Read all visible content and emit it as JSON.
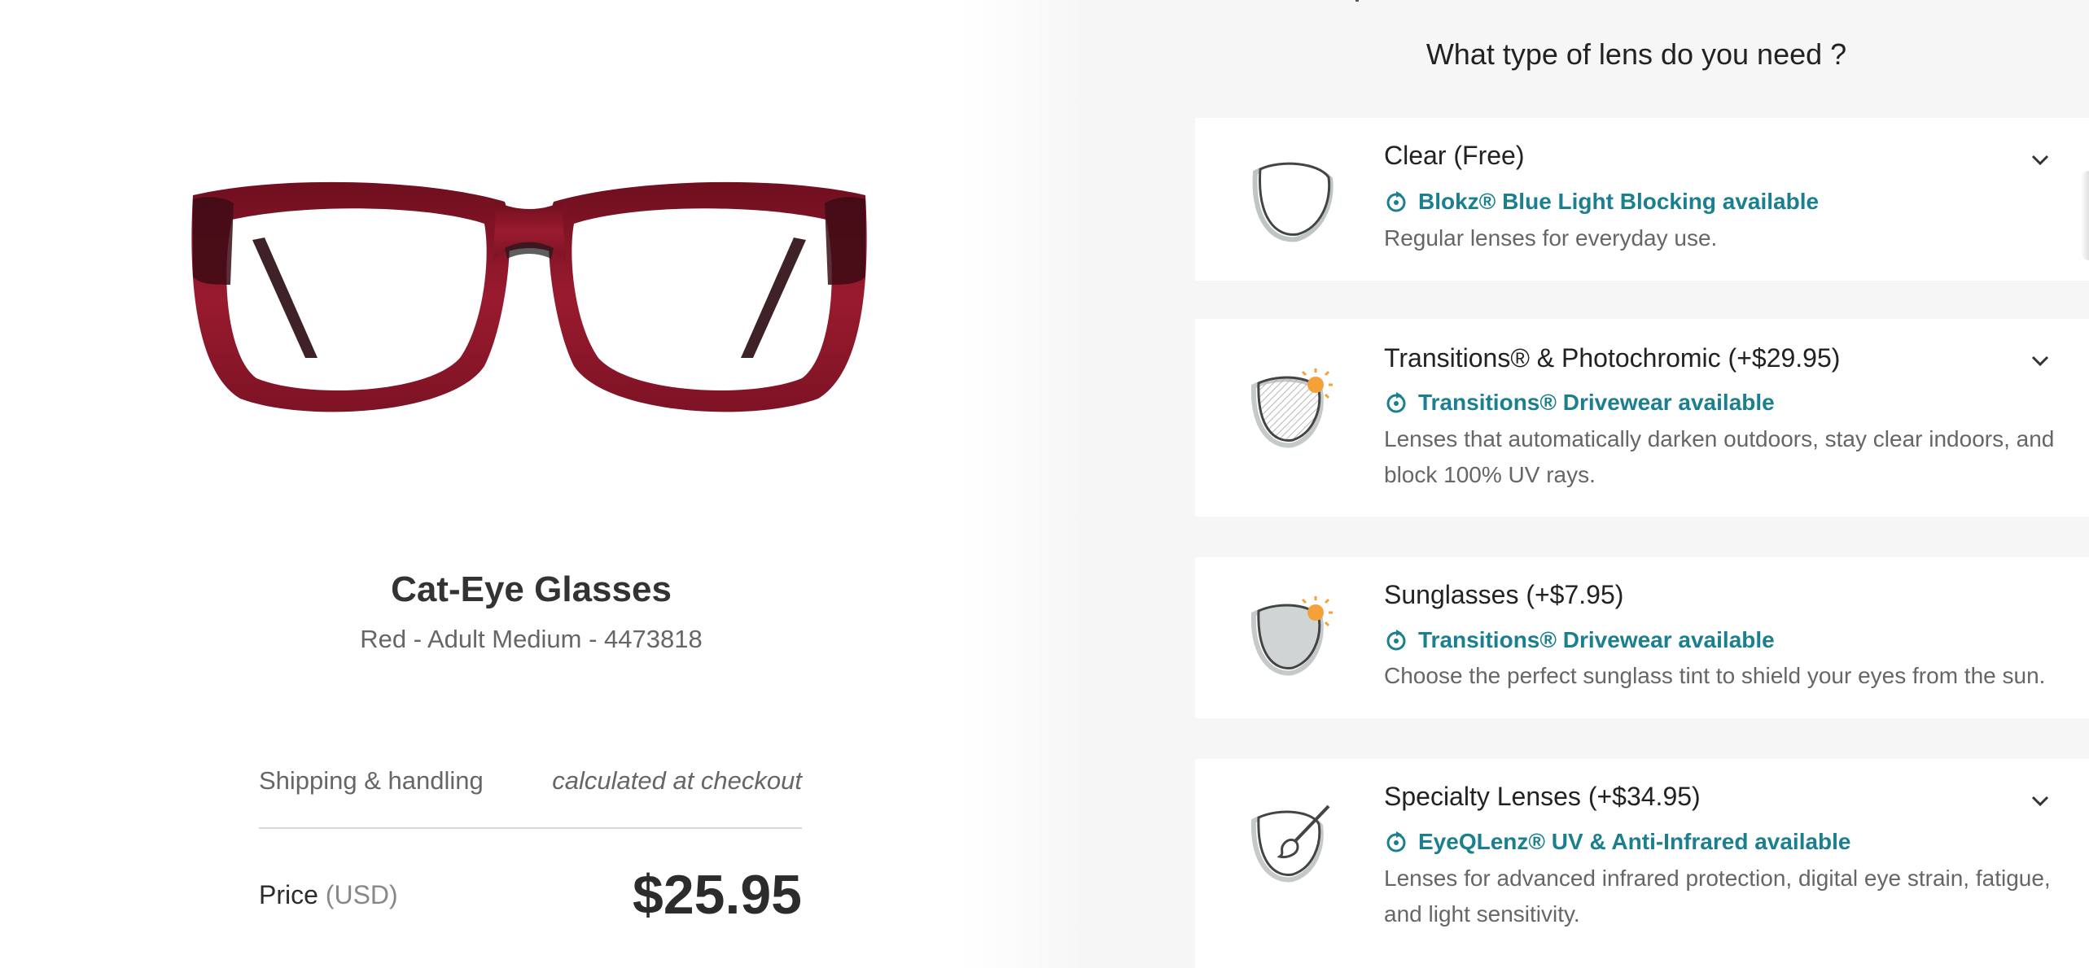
{
  "product": {
    "name": "Cat-Eye Glasses",
    "details": "Red - Adult Medium - 4473818",
    "frame_color": "#8b1628"
  },
  "summary": {
    "shipping_label": "Shipping & handling",
    "shipping_value": "calculated at checkout",
    "price_label": "Price",
    "price_currency": "(USD)",
    "price_value": "$25.95"
  },
  "lens_selector": {
    "question": "What type of lens do you need ?",
    "accent_color": "#1a7f8e",
    "options": [
      {
        "title": "Clear",
        "price": "(Free)",
        "feature": "Blokz® Blue Light Blocking available",
        "description": "Regular lenses for everyday use.",
        "icon": "clear-lens-icon",
        "expandable": true
      },
      {
        "title": "Transitions® & Photochromic",
        "price": "(+$29.95)",
        "feature": "Transitions® Drivewear available",
        "description": "Lenses that automatically darken outdoors, stay clear indoors, and block 100% UV rays.",
        "icon": "photochromic-lens-icon",
        "expandable": true
      },
      {
        "title": "Sunglasses",
        "price": "(+$7.95)",
        "feature": "Transitions® Drivewear available",
        "description": "Choose the perfect sunglass tint to shield your eyes from the sun.",
        "icon": "sunglasses-lens-icon",
        "expandable": false
      },
      {
        "title": "Specialty Lenses",
        "price": "(+$34.95)",
        "feature": "EyeQLenz® UV & Anti-Infrared available",
        "description": "Lenses for advanced infrared protection, digital eye strain, fatigue, and light sensitivity.",
        "icon": "specialty-lens-icon",
        "expandable": true
      }
    ]
  }
}
